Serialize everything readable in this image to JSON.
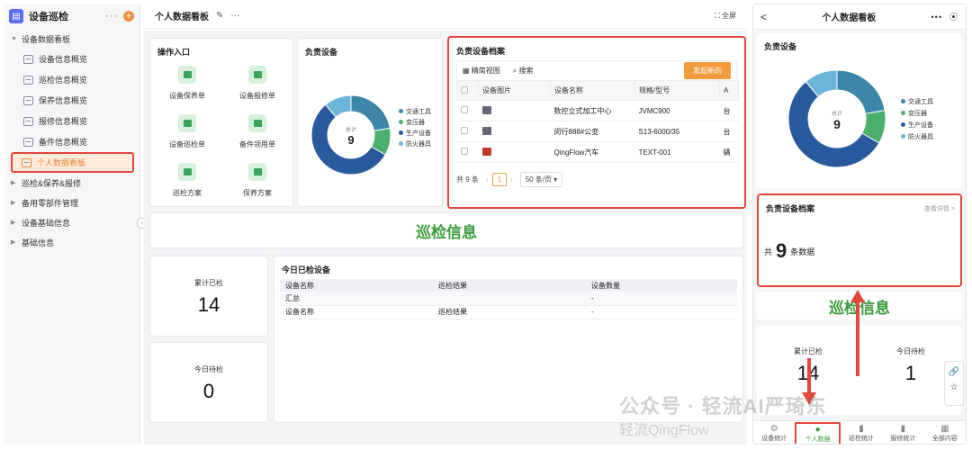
{
  "sidebar": {
    "app_name": "设备巡检",
    "more": "···",
    "add": "+",
    "groups": [
      {
        "label": "设备数据看板"
      },
      {
        "label": "巡检&保养&报修"
      },
      {
        "label": "备用零部件管理"
      },
      {
        "label": "设备基础信息"
      },
      {
        "label": "基础信息"
      }
    ],
    "items": [
      {
        "label": "设备信息概览"
      },
      {
        "label": "巡检信息概览"
      },
      {
        "label": "保养信息概览"
      },
      {
        "label": "报修信息概览"
      },
      {
        "label": "备件信息概览"
      },
      {
        "label": "个人数据看板"
      }
    ]
  },
  "topbar": {
    "title": "个人数据看板",
    "more": "···",
    "fullscreen": "全屏"
  },
  "entry": {
    "title": "操作入口",
    "items": [
      {
        "label": "设备保养单"
      },
      {
        "label": "设备报修单"
      },
      {
        "label": "设备巡检单"
      },
      {
        "label": "备件领用单"
      },
      {
        "label": "巡检方案"
      },
      {
        "label": "保养方案"
      }
    ]
  },
  "responsible": {
    "title": "负责设备",
    "center_label": "总计",
    "center_value": "9",
    "legend": [
      {
        "name": "交通工具",
        "color": "#3d86a8"
      },
      {
        "name": "变压器",
        "color": "#4caf6e"
      },
      {
        "name": "生产设备",
        "color": "#2a5a9e"
      },
      {
        "name": "防火器具",
        "color": "#6bb5d8"
      }
    ]
  },
  "chart_data": {
    "type": "pie",
    "title": "负责设备",
    "categories": [
      "交通工具",
      "变压器",
      "生产设备",
      "防火器具"
    ],
    "values": [
      2,
      1,
      5,
      1
    ],
    "total": 9
  },
  "archive": {
    "title": "负责设备档案",
    "view_label": "精简视图",
    "search_label": "搜索",
    "new_button": "发起新的",
    "columns": [
      "设备图片",
      "设备名称",
      "规格/型号",
      "A"
    ],
    "rows": [
      {
        "name": "数控立式加工中心",
        "spec": "JVMC900",
        "extra": "台"
      },
      {
        "name": "闵行888#公变",
        "spec": "S13-6000/35",
        "extra": "台"
      },
      {
        "name": "QingFlow汽车",
        "spec": "TEXT-001",
        "extra": "辆"
      }
    ],
    "total_text": "共 9 条",
    "page": "1",
    "page_size": "50 条/页"
  },
  "inspect_banner": "巡检信息",
  "stats": [
    {
      "label": "累计已检",
      "value": "14"
    },
    {
      "label": "今日待检",
      "value": "0"
    }
  ],
  "today": {
    "title": "今日已检设备",
    "columns": [
      "设备名称",
      "巡检结果",
      "设备数量"
    ],
    "rows": [
      {
        "c1": "汇总",
        "c2": "",
        "c3": "-"
      },
      {
        "c1": "设备名称",
        "c2": "巡检结果",
        "c3": "-"
      }
    ]
  },
  "mobile": {
    "back": "<",
    "title": "个人数据看板",
    "more": "•••",
    "target": "⦿",
    "resp_title": "负责设备",
    "center_label": "总计",
    "center_value": "9",
    "legend": [
      "交通工具",
      "变压器",
      "生产设备",
      "防火器具"
    ],
    "arch_title": "负责设备档案",
    "detail": "查看详情 >",
    "count_prefix": "共",
    "count_value": "9",
    "count_suffix": "条数据",
    "banner": "巡检信息",
    "stats": [
      {
        "label": "累计已检",
        "value": "14"
      },
      {
        "label": "今日待检",
        "value": "1"
      }
    ],
    "nav": [
      "设备统计",
      "个人数据",
      "巡检统计",
      "报修统计",
      "全部内容"
    ]
  },
  "watermark": "公众号 · 轻流AI严琦东",
  "watermark_brand": "轻流QingFlow"
}
